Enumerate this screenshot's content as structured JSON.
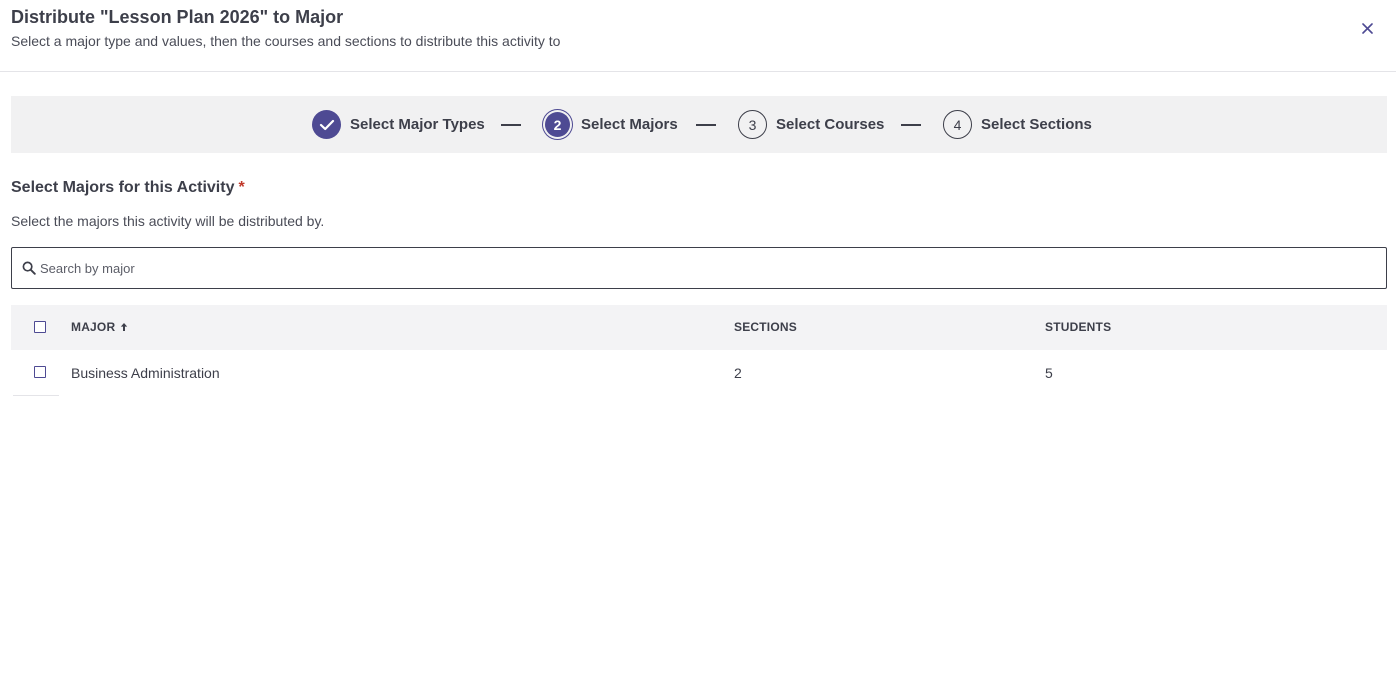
{
  "dialog": {
    "title": "Distribute \"Lesson Plan 2026\" to Major",
    "subtitle": "Select a major type and values, then the courses and sections to distribute this activity to",
    "close_icon": "close-icon"
  },
  "stepper": {
    "steps": [
      {
        "number": "",
        "label": "Select Major Types",
        "state": "completed"
      },
      {
        "number": "2",
        "label": "Select Majors",
        "state": "active"
      },
      {
        "number": "3",
        "label": "Select Courses",
        "state": "upcoming"
      },
      {
        "number": "4",
        "label": "Select Sections",
        "state": "upcoming"
      }
    ]
  },
  "section": {
    "title": "Select Majors for this Activity",
    "required_mark": "*",
    "description": "Select the majors this activity will be distributed by."
  },
  "search": {
    "placeholder": "Search by major",
    "value": ""
  },
  "table": {
    "columns": [
      "MAJOR",
      "SECTIONS",
      "STUDENTS"
    ],
    "sort": {
      "column": "MAJOR",
      "direction": "ascending"
    },
    "rows": [
      {
        "major": "Business Administration",
        "sections": "2",
        "students": "5",
        "selected": false
      }
    ]
  },
  "colors": {
    "accent": "#4e4a93",
    "text": "#3d3f4a",
    "stepper_bg": "#f1f1f2",
    "required": "#c0392b"
  }
}
